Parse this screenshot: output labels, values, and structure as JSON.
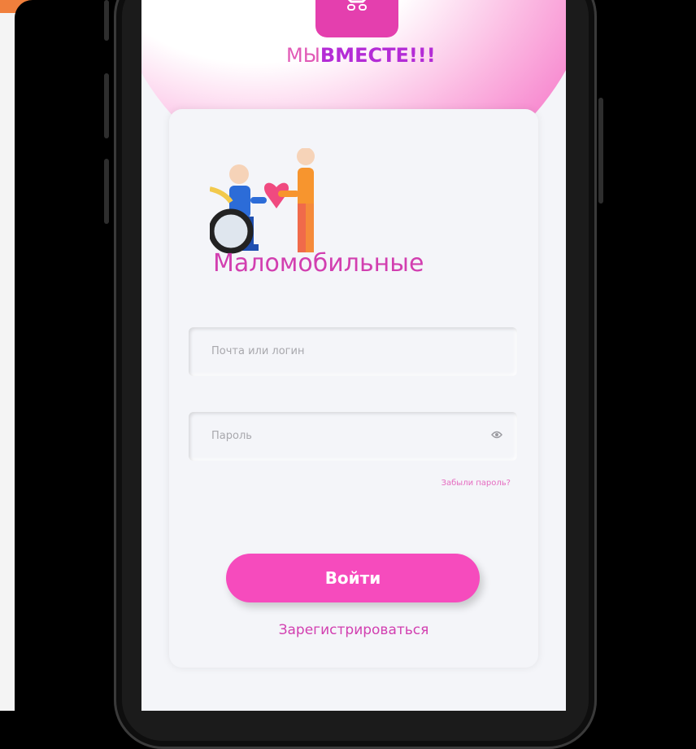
{
  "brand": {
    "prefix": "МЫ",
    "highlight": "ВМЕСТЕ!!!"
  },
  "card": {
    "title": "Маломобильные"
  },
  "form": {
    "email_placeholder": "Почта или логин",
    "password_placeholder": "Пароль",
    "forgot_label": "Забыли пароль?",
    "login_label": "Войти",
    "register_label": "Зарегистрироваться"
  },
  "icons": {
    "app_logo": "app-logo-icon",
    "illustration": "wheelchair-helper-illustration",
    "password_toggle": "eye-icon"
  },
  "colors": {
    "accent": "#f64bbd",
    "title": "#d23fb0",
    "brand_highlight": "#b42cd6"
  }
}
